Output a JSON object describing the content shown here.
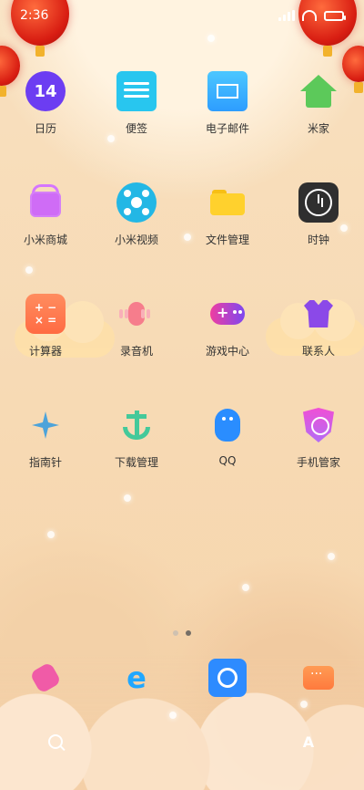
{
  "status_bar": {
    "time": "2:36"
  },
  "apps": [
    {
      "label": "日历",
      "icon": "calendar-icon",
      "badge_text": "14"
    },
    {
      "label": "便签",
      "icon": "note-icon"
    },
    {
      "label": "电子邮件",
      "icon": "mail-icon"
    },
    {
      "label": "米家",
      "icon": "home-icon"
    },
    {
      "label": "小米商城",
      "icon": "gift-icon"
    },
    {
      "label": "小米视频",
      "icon": "video-icon"
    },
    {
      "label": "文件管理",
      "icon": "folder-icon"
    },
    {
      "label": "时钟",
      "icon": "clock-icon"
    },
    {
      "label": "计算器",
      "icon": "calculator-icon"
    },
    {
      "label": "录音机",
      "icon": "recorder-icon"
    },
    {
      "label": "游戏中心",
      "icon": "game-icon"
    },
    {
      "label": "联系人",
      "icon": "contacts-icon"
    },
    {
      "label": "指南针",
      "icon": "compass-icon"
    },
    {
      "label": "下载管理",
      "icon": "anchor-icon"
    },
    {
      "label": "QQ",
      "icon": "qq-icon"
    },
    {
      "label": "手机管家",
      "icon": "security-icon"
    }
  ],
  "page_indicator": {
    "pages": 2,
    "active_index": 1
  },
  "dock": [
    {
      "icon": "phone-icon"
    },
    {
      "icon": "browser-icon"
    },
    {
      "icon": "camera-icon"
    },
    {
      "icon": "messages-icon"
    }
  ],
  "bottom_shortcuts": [
    {
      "icon": "search-icon"
    },
    {
      "icon": "mi-icon"
    }
  ],
  "colors": {
    "calendar": "#6c3df2",
    "note": "#28c6ef",
    "mail": "#2d9dff",
    "home": "#5cc95a",
    "gift": "#cf6cf6",
    "video": "#23b7e5",
    "folder": "#ffd12d",
    "clock": "#2f2f2f",
    "calculator": "#ff6b43",
    "recorder": "#f67d8c",
    "game": "#ef3ea1",
    "contacts": "#8b49e8",
    "compass": "#4da3da",
    "anchor": "#44c99a",
    "qq": "#2a8dff",
    "security": "#f04fd5"
  }
}
